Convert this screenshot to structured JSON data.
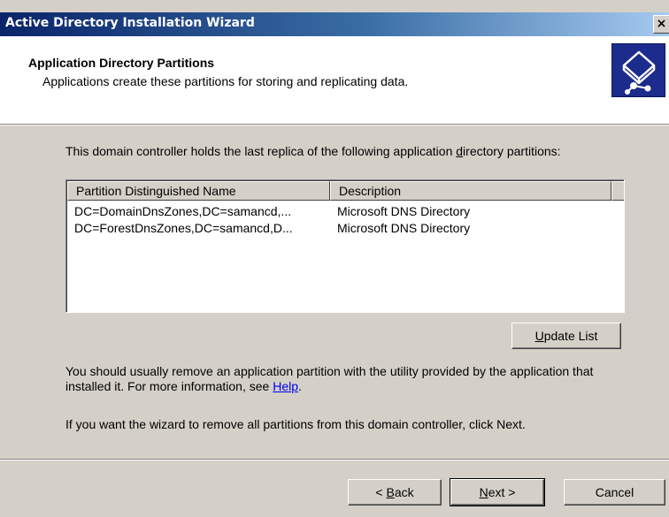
{
  "window": {
    "title": "Active Directory Installation Wizard",
    "close_glyph": "×"
  },
  "header": {
    "title": "Application Directory Partitions",
    "subtitle": "Applications create these partitions for storing and replicating data.",
    "icon": "directory-tree-icon",
    "icon_colors": {
      "background": "#1c2c8c",
      "symbol": "#ffffff"
    }
  },
  "intro": {
    "text_before": "This domain controller holds the last replica of the following application ",
    "accel": "d",
    "text_after": "irectory partitions:"
  },
  "partitions": {
    "columns": [
      "Partition Distinguished Name",
      "Description"
    ],
    "rows": [
      {
        "name": "DC=DomainDnsZones,DC=samancd,...",
        "description": "Microsoft DNS Directory"
      },
      {
        "name": "DC=ForestDnsZones,DC=samancd,D...",
        "description": "Microsoft DNS Directory"
      }
    ]
  },
  "update_button": {
    "accel": "U",
    "rest": "pdate List"
  },
  "info": {
    "para1_text": "You should usually remove an application partition with the utility provided by the application that installed it. For more information, see ",
    "help_link": "Help",
    "para1_end": ".",
    "para2": "If you want the wizard to remove all partitions from this domain controller, click Next."
  },
  "buttons": {
    "back": {
      "prefix": "< ",
      "accel": "B",
      "rest": "ack"
    },
    "next": {
      "accel": "N",
      "rest": "ext >"
    },
    "cancel": "Cancel"
  },
  "colors": {
    "titlebar_start": "#0a246a",
    "titlebar_end": "#a6caf0",
    "dialog_face": "#d4d0c8",
    "link": "#0000ee"
  }
}
